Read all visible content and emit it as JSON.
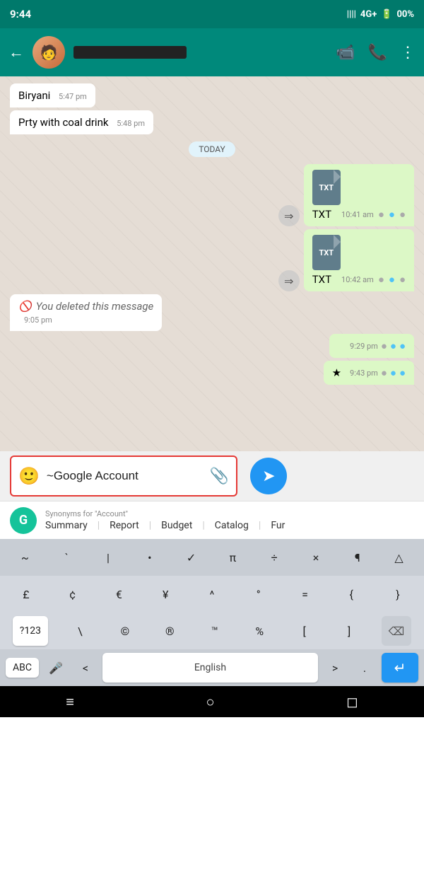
{
  "statusBar": {
    "time": "9:44",
    "signal": "||||",
    "network": "4G+",
    "battery": "00%"
  },
  "header": {
    "contactName": "████████████",
    "backLabel": "←",
    "videoIcon": "📹",
    "phoneIcon": "📞",
    "menuIcon": "⋮"
  },
  "messages": [
    {
      "type": "incoming",
      "text": "Biryani",
      "time": "5:47 pm"
    },
    {
      "type": "incoming",
      "text": "Prty with coal drink",
      "time": "5:48 pm"
    },
    {
      "type": "today",
      "text": "TODAY"
    },
    {
      "type": "outgoing-file",
      "fileType": "TXT",
      "time": "10:41 am"
    },
    {
      "type": "outgoing-file",
      "fileType": "TXT",
      "time": "10:42 am"
    },
    {
      "type": "deleted",
      "text": "You deleted this message",
      "time": "9:05 pm"
    },
    {
      "type": "outgoing-blank",
      "time": "9:29 pm"
    },
    {
      "type": "outgoing-blank2",
      "time": "9:43 pm",
      "star": true
    }
  ],
  "inputBar": {
    "emoji": "🙂",
    "text": "~Google Account",
    "attach": "📎",
    "sendIcon": "➤"
  },
  "grammarly": {
    "logoLetter": "G",
    "hint": "Synonyms for \"Account\"",
    "suggestions": [
      "Summary",
      "Report",
      "Budget",
      "Catalog",
      "Fur"
    ]
  },
  "keyboard": {
    "specialRow": [
      "~",
      "`",
      "|",
      "•",
      "✓",
      "π",
      "÷",
      "×",
      "¶",
      "△"
    ],
    "symbolRow": [
      "£",
      "¢",
      "€",
      "¥",
      "^",
      "°",
      "=",
      "{",
      "}"
    ],
    "bottomLeft": "?123",
    "bottomKeys": [
      "\\",
      "©",
      "®",
      "™",
      "%",
      "[",
      "]"
    ],
    "spaceLang": "English",
    "enterIcon": "↵",
    "abcLabel": "ABC",
    "micIcon": "🎤",
    "ltKey": "<",
    "gtKey": ">",
    "dotKey": "."
  },
  "navBar": {
    "homeIcon": "≡",
    "circleIcon": "○",
    "backIcon": "◻"
  }
}
